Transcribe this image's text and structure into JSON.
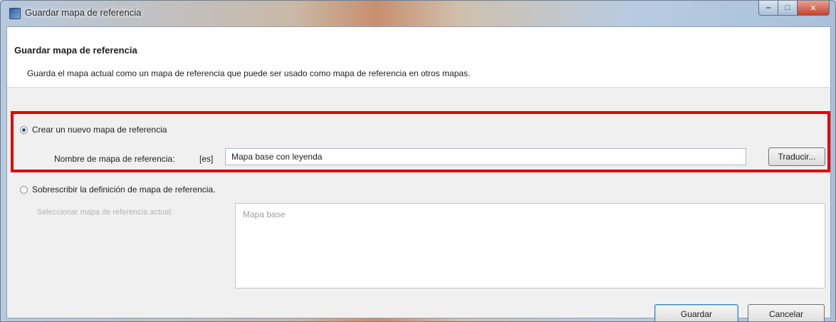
{
  "window": {
    "title": "Guardar mapa de referencia",
    "controls": {
      "minimize": "‒",
      "maximize": "□",
      "close": "✕"
    }
  },
  "header": {
    "title": "Guardar mapa de referencia",
    "description": "Guarda el mapa actual como un mapa de referencia que puede ser usado como mapa de referencia en otros mapas."
  },
  "options": {
    "new_map": {
      "label": "Crear un nuevo mapa de referencia",
      "selected": true,
      "name_label": "Nombre de mapa de referencia:",
      "language": "[es]",
      "name_value": "Mapa base con leyenda",
      "translate_button": "Traducir..."
    },
    "overwrite": {
      "label": "Sobrescribir la definición de mapa de referencia.",
      "selected": false,
      "select_label": "Seleccionar mapa de referencia actual:",
      "items": [
        "Mapa base"
      ]
    }
  },
  "buttons": {
    "save": "Guardar",
    "cancel": "Cancelar"
  },
  "colors": {
    "highlight": "#e00000",
    "accent": "#2a4e8a"
  }
}
